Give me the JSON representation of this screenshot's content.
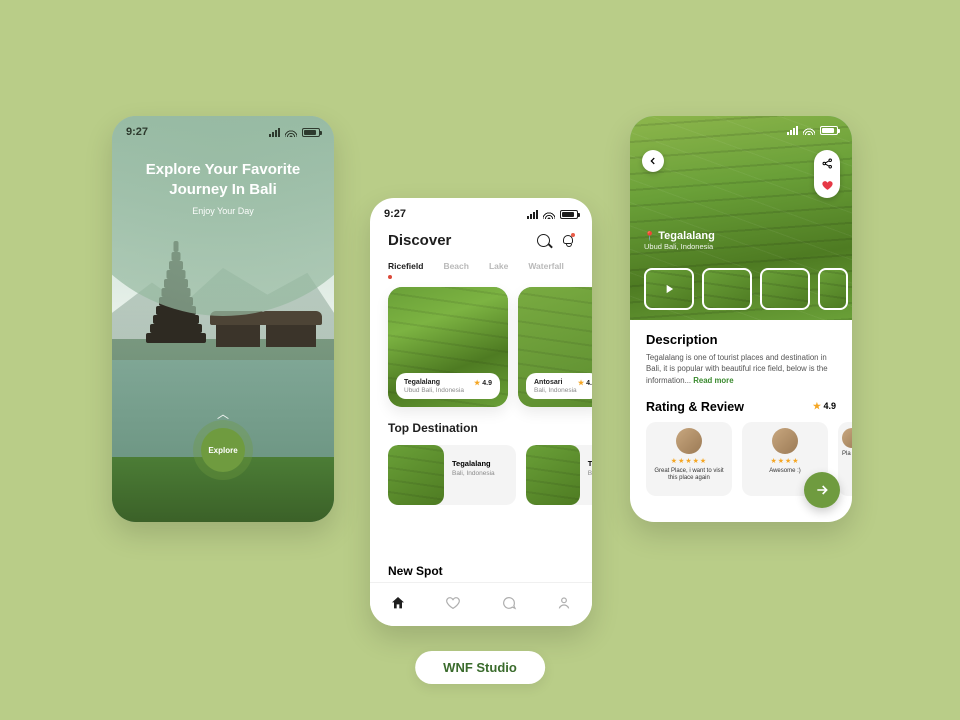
{
  "status_time": "9:27",
  "studio": "WNF Studio",
  "colors": {
    "accent": "#6f9b3f",
    "star": "#f5a623",
    "heart": "#e63946"
  },
  "screen1": {
    "title_line1": "Explore Your Favorite",
    "title_line2": "Journey In Bali",
    "subtitle": "Enjoy Your Day",
    "explore_label": "Explore"
  },
  "screen2": {
    "title": "Discover",
    "tabs": [
      "Ricefield",
      "Beach",
      "Lake",
      "Waterfall"
    ],
    "active_tab_index": 0,
    "cards": [
      {
        "name": "Tegalalang",
        "location": "Ubud Bali, Indonesia",
        "rating": "4.9"
      },
      {
        "name": "Antosari",
        "location": "Bali, Indonesia",
        "rating": "4."
      }
    ],
    "top_destination_label": "Top Destination",
    "destinations": [
      {
        "name": "Tegalalang",
        "location": "Bali, Indonesia"
      },
      {
        "name": "Te",
        "location": "Ba"
      }
    ],
    "new_spot_label": "New  Spot",
    "nav": [
      "home",
      "heart",
      "chat",
      "user"
    ],
    "nav_active_index": 0
  },
  "screen3": {
    "place_name": "Tegalalang",
    "place_location": "Ubud Bali, Indonesia",
    "description_heading": "Description",
    "description_text": "Tegalalang is one of tourist places and destination in Bali, it is popular with beautiful rice field, below is the information...",
    "read_more": "Read more",
    "rating_heading": "Rating & Review",
    "rating_value": "4.9",
    "reviews": [
      {
        "stars": "★★★★★",
        "text": "Great Place, i want to visit this place again"
      },
      {
        "stars": "★★★★",
        "text": "Awesome :)"
      },
      {
        "stars": "",
        "text": "Pla"
      }
    ]
  }
}
